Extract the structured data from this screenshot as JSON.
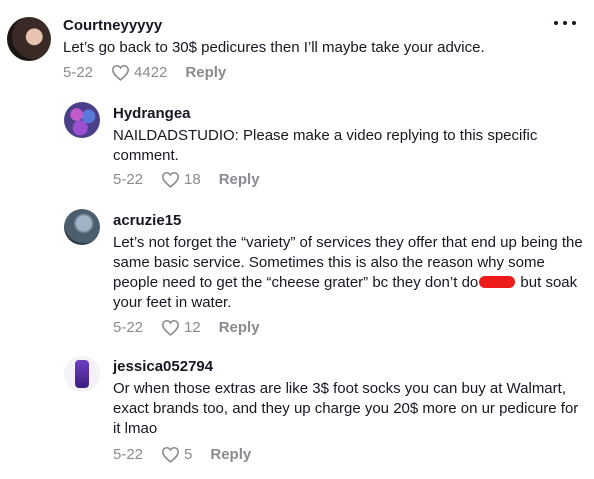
{
  "comments": [
    {
      "username": "Courtneyyyyy",
      "text": "Let’s go back to 30$ pedicures then I’ll maybe take your advice.",
      "date": "5-22",
      "likes": "4422",
      "reply_label": "Reply",
      "avatar_icon": "user-avatar-photo"
    },
    {
      "username": "Hydrangea",
      "text": "NAILDADSTUDIO: Please make a video replying to this specific comment.",
      "date": "5-22",
      "likes": "18",
      "reply_label": "Reply",
      "avatar_icon": "hydrangea-flower-avatar"
    },
    {
      "username": "acruzie15",
      "text_before": "Let’s not forget the “variety” of services they offer that end up being the same basic service. Sometimes this is also the reason why some people need to get the “cheese grater” bc they don’t do",
      "text_after": " but soak your feet in water.",
      "date": "5-22",
      "likes": "12",
      "reply_label": "Reply",
      "avatar_icon": "user-avatar-photo"
    },
    {
      "username": "jessica052794",
      "text": "Or when those extras are like 3$ foot socks you can buy at Walmart, exact brands too, and they up charge you 20$ more on ur pedicure for it lmao",
      "date": "5-22",
      "likes": "5",
      "reply_label": "Reply",
      "avatar_icon": "purple-bottle-avatar"
    }
  ],
  "more_icon": "more-options-icon",
  "colors": {
    "text": "#161823",
    "meta": "#8a8b91",
    "redaction": "#ee1b1b"
  }
}
